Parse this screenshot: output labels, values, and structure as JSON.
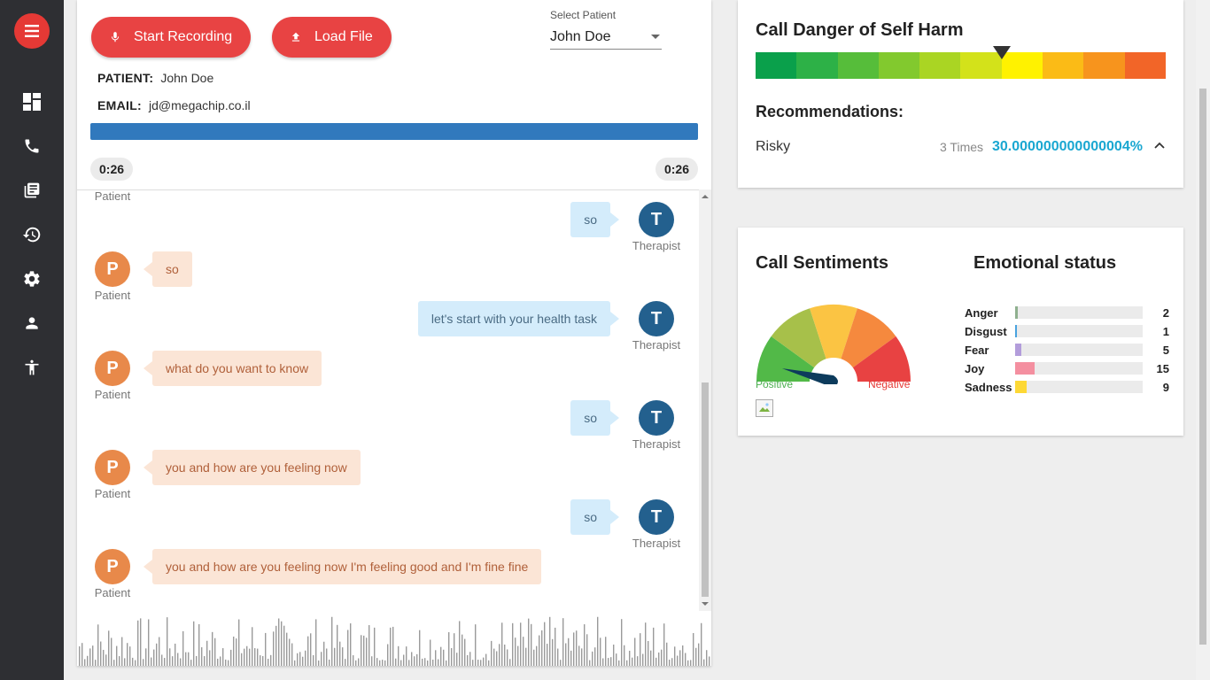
{
  "sidebar": {
    "menu_icon": "hamburger-icon",
    "items": [
      {
        "name": "dashboard",
        "icon": "dashboard-icon"
      },
      {
        "name": "calls",
        "icon": "phone-icon"
      },
      {
        "name": "library",
        "icon": "library-icon"
      },
      {
        "name": "history",
        "icon": "history-icon"
      },
      {
        "name": "settings",
        "icon": "gear-icon"
      },
      {
        "name": "profile",
        "icon": "person-icon"
      },
      {
        "name": "accessibility",
        "icon": "accessibility-icon"
      }
    ]
  },
  "toolbar": {
    "start_recording": "Start Recording",
    "load_file": "Load File"
  },
  "patient_select": {
    "label": "Select Patient",
    "value": "John Doe"
  },
  "patient_info": {
    "patient_label": "PATIENT:",
    "patient_value": "John Doe",
    "email_label": "EMAIL:",
    "email_value": "jd@megachip.co.il"
  },
  "playback": {
    "progress": 1.0,
    "current_time": "0:26",
    "total_time": "0:26"
  },
  "chat": {
    "top_partial_role": "Patient",
    "messages": [
      {
        "speaker": "therapist",
        "initial": "T",
        "role": "Therapist",
        "text": "so"
      },
      {
        "speaker": "patient",
        "initial": "P",
        "role": "Patient",
        "text": "so"
      },
      {
        "speaker": "therapist",
        "initial": "T",
        "role": "Therapist",
        "text": "let's start with your health task"
      },
      {
        "speaker": "patient",
        "initial": "P",
        "role": "Patient",
        "text": "what do you want to know"
      },
      {
        "speaker": "therapist",
        "initial": "T",
        "role": "Therapist",
        "text": "so"
      },
      {
        "speaker": "patient",
        "initial": "P",
        "role": "Patient",
        "text": "you and how are you feeling now"
      },
      {
        "speaker": "therapist",
        "initial": "T",
        "role": "Therapist",
        "text": "so"
      },
      {
        "speaker": "patient",
        "initial": "P",
        "role": "Patient",
        "text": "you and how are you feeling now I'm feeling good and I'm fine fine"
      }
    ]
  },
  "danger": {
    "title": "Call Danger of Self Harm",
    "level_index": 6,
    "level_count": 10,
    "scale_colors": [
      "#0aa04b",
      "#2db147",
      "#56bd3a",
      "#82c92e",
      "#aad523",
      "#d3e21a",
      "#fff200",
      "#fbbb16",
      "#f7941d",
      "#f26528"
    ],
    "recommendations_title": "Recommendations:",
    "recommendation": {
      "label": "Risky",
      "times": "3 Times",
      "percent": "30.000000000000004%"
    }
  },
  "sentiments": {
    "title": "Call Sentiments",
    "positive_label": "Positive",
    "negative_label": "Negative",
    "needle_level": 0.08,
    "gauge_colors": [
      "#52b948",
      "#a7c04a",
      "#fbc443",
      "#f5893e",
      "#e84242"
    ]
  },
  "emotions": {
    "title": "Emotional status",
    "max": 100,
    "items": [
      {
        "name": "Anger",
        "value": 2,
        "color": "#8fb08f"
      },
      {
        "name": "Disgust",
        "value": 1,
        "color": "#4aa3df"
      },
      {
        "name": "Fear",
        "value": 5,
        "color": "#b39ddb"
      },
      {
        "name": "Joy",
        "value": 15,
        "color": "#f48fa0"
      },
      {
        "name": "Sadness",
        "value": 9,
        "color": "#fdd835"
      }
    ]
  }
}
